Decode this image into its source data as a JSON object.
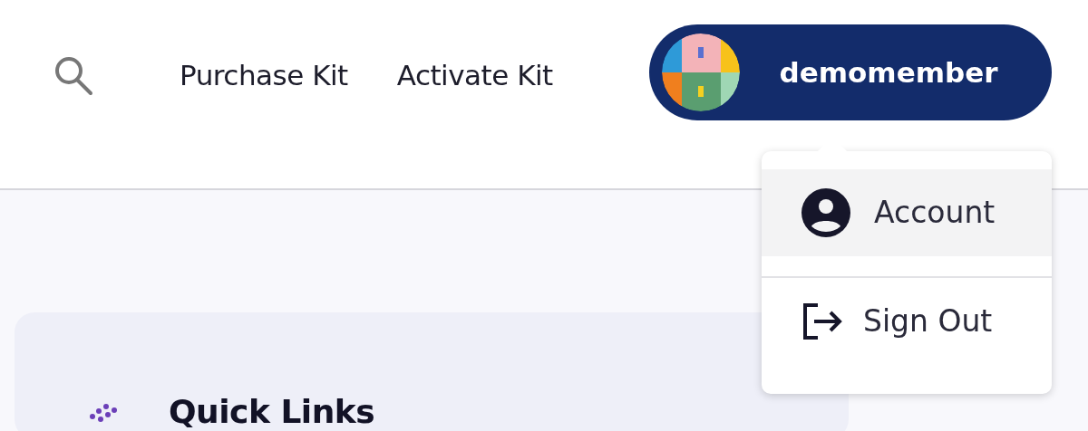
{
  "header": {
    "nav_links": [
      "Purchase Kit",
      "Activate Kit"
    ],
    "user": {
      "name": "demomember"
    }
  },
  "user_menu": {
    "items": [
      {
        "kind": "account",
        "label": "Account",
        "highlighted": true
      },
      {
        "kind": "sign_out",
        "label": "Sign Out",
        "highlighted": false
      }
    ]
  },
  "quick_links": {
    "title": "Quick Links"
  }
}
